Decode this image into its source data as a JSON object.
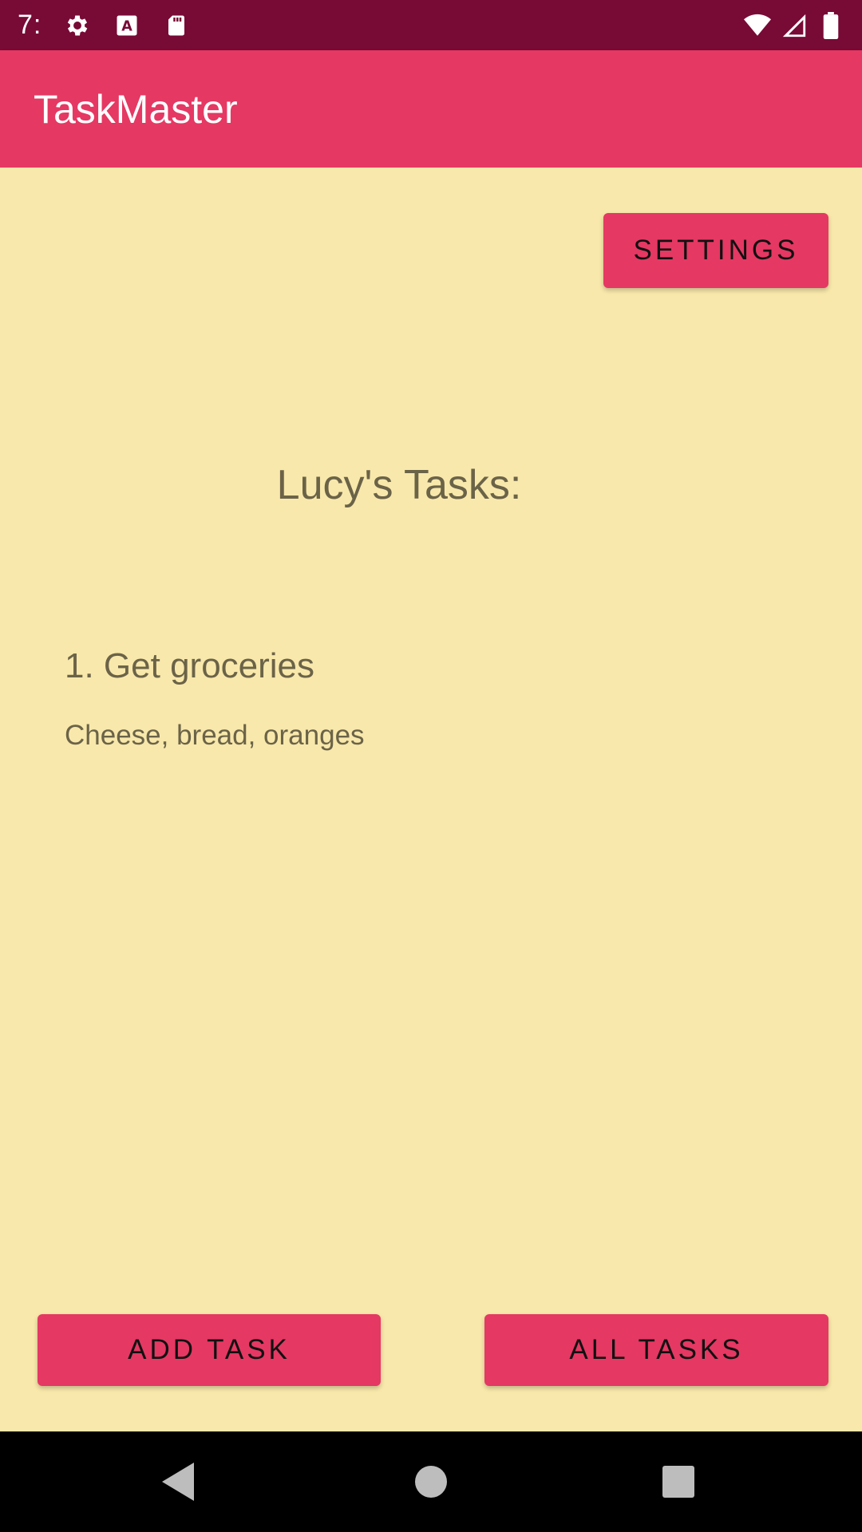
{
  "status_bar": {
    "time": "7:",
    "icons": [
      "gear-icon",
      "keyboard-a-icon",
      "sd-card-icon",
      "wifi-icon",
      "signal-icon",
      "battery-icon"
    ]
  },
  "app_bar": {
    "title": "TaskMaster"
  },
  "main": {
    "settings_label": "SETTINGS",
    "heading": "Lucy's Tasks:",
    "task": {
      "title": "1. Get groceries",
      "description": "Cheese, bread, oranges"
    },
    "add_task_label": "ADD TASK",
    "all_tasks_label": "ALL TASKS"
  },
  "colors": {
    "status_bar": "#780a36",
    "accent": "#e53863",
    "background": "#f8e8ab",
    "text": "#6b6348"
  },
  "nav_bar": {
    "icons": [
      "back-icon",
      "home-icon",
      "recents-icon"
    ]
  }
}
